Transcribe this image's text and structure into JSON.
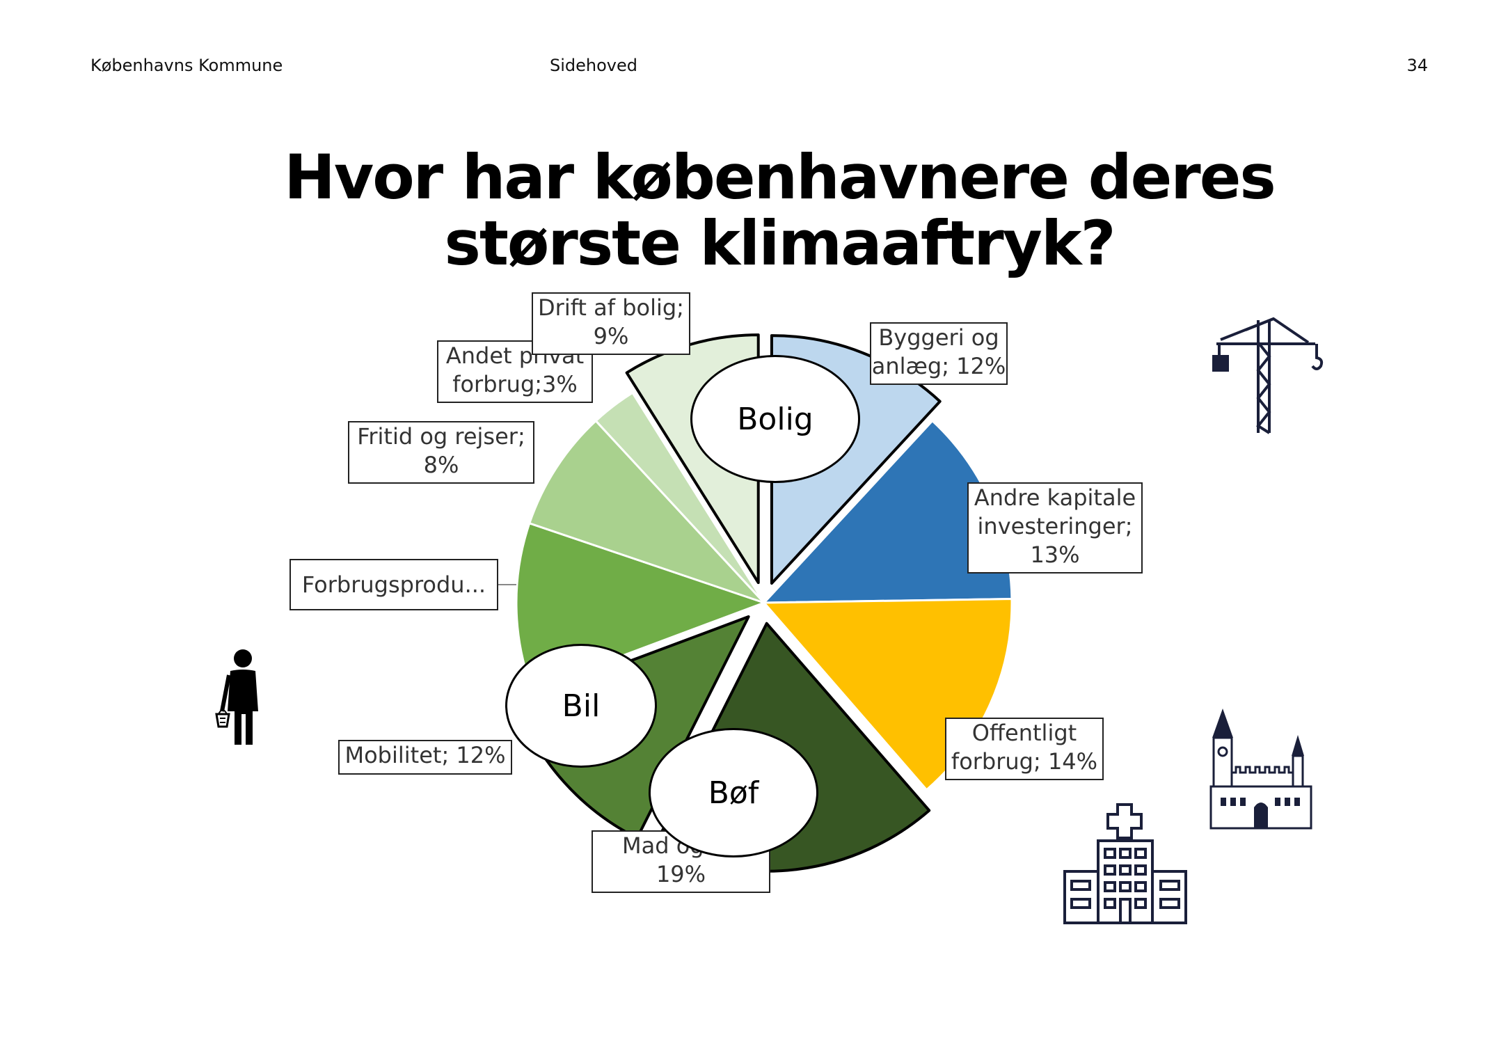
{
  "header": {
    "left": "Københavns Kommune",
    "center": "Sidehoved",
    "page_number": "34"
  },
  "title_line1": "Hvor har københavnere deres",
  "title_line2": "største klimaaftryk?",
  "groups": {
    "bolig": "Bolig",
    "bil": "Bil",
    "bof": "Bøf"
  },
  "chart_data": {
    "type": "pie",
    "title": "Hvor har københavnere deres største klimaaftryk?",
    "slices": [
      {
        "label": "Byggeri og anlæg",
        "value": 12,
        "display": "Byggeri og\nanlæg; 12%",
        "color": "#BDD7EE",
        "exploded": true
      },
      {
        "label": "Andre kapitale investeringer",
        "value": 13,
        "display": "Andre kapitale\ninvesteringer;\n13%",
        "color": "#2E75B6",
        "exploded": false
      },
      {
        "label": "Offentligt forbrug",
        "value": 14,
        "display": "Offentligt\nforbrug; 14%",
        "color": "#FFC000",
        "exploded": false
      },
      {
        "label": "Mad og drikke",
        "value": 19,
        "display": "Mad og d      ;\n19%",
        "color": "#375623",
        "exploded": true
      },
      {
        "label": "Mobilitet",
        "value": 12,
        "display": "Mobilitet; 12%",
        "color": "#548235",
        "exploded": true
      },
      {
        "label": "Forbrugsprodukter",
        "value": 11,
        "display": "Forbrugsprodu...",
        "color": "#70AD47",
        "exploded": false
      },
      {
        "label": "Fritid og rejser",
        "value": 8,
        "display": "Fritid og rejser;\n8%",
        "color": "#A9D18E",
        "exploded": false
      },
      {
        "label": "Andet privat forbrug",
        "value": 3,
        "display": "Andet privat\nforbrug;3%",
        "color": "#C5E0B4",
        "exploded": false
      },
      {
        "label": "Drift af bolig",
        "value": 9,
        "display": "Drift af bolig;\n9%",
        "color": "#E2EFDA",
        "exploded": true
      }
    ]
  },
  "icons": [
    "person-with-basket-icon",
    "construction-crane-icon",
    "hospital-icon",
    "city-hall-icon"
  ]
}
